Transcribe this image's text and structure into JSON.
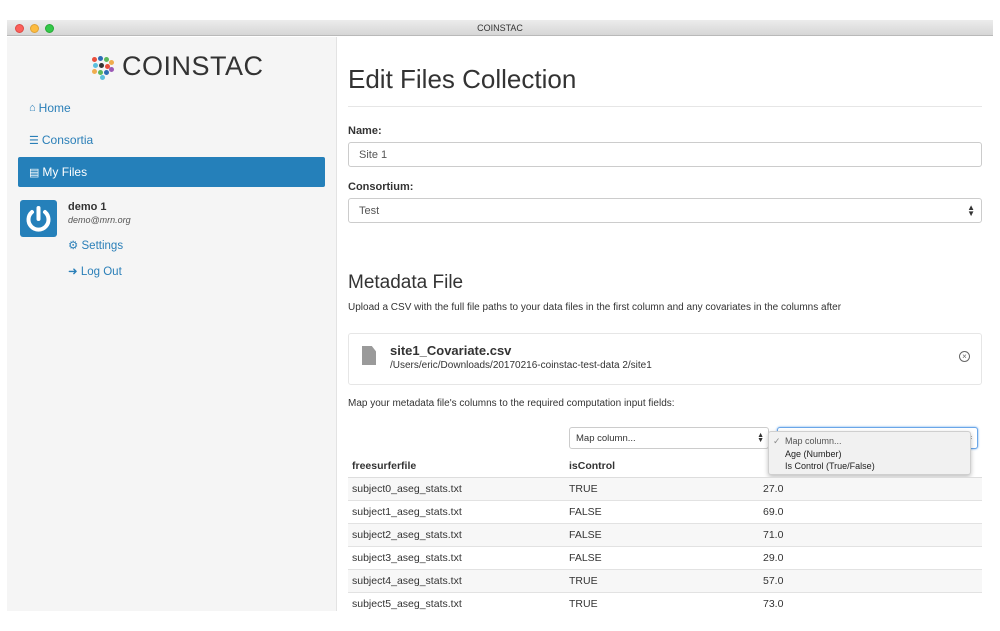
{
  "window": {
    "title": "COINSTAC"
  },
  "brand": {
    "name": "COINSTAC"
  },
  "sidebar": {
    "items": [
      {
        "label": "Home",
        "icon": "home-icon"
      },
      {
        "label": "Consortia",
        "icon": "list-icon"
      },
      {
        "label": "My Files",
        "icon": "file-list-icon"
      }
    ],
    "user": {
      "name": "demo 1",
      "email": "demo@mrn.org"
    },
    "links": {
      "settings": "Settings",
      "logout": "Log Out"
    }
  },
  "main": {
    "title": "Edit Files Collection",
    "name_label": "Name:",
    "name_value": "Site 1",
    "consortium_label": "Consortium:",
    "consortium_value": "Test",
    "metadata_title": "Metadata File",
    "metadata_desc": "Upload a CSV with the full file paths to your data files in the first column and any covariates in the columns after",
    "file": {
      "name": "site1_Covariate.csv",
      "path": "/Users/eric/Downloads/20170216-coinstac-test-data 2/site1"
    },
    "map_desc": "Map your metadata file's columns to the required computation input fields:",
    "map_select_1": "Map column...",
    "dropdown_options": [
      "Map column...",
      "Age (Number)",
      "Is Control (True/False)"
    ],
    "table": {
      "headers": [
        "freesurferfile",
        "isControl",
        ""
      ],
      "rows": [
        [
          "subject0_aseg_stats.txt",
          "TRUE",
          "27.0"
        ],
        [
          "subject1_aseg_stats.txt",
          "FALSE",
          "69.0"
        ],
        [
          "subject2_aseg_stats.txt",
          "FALSE",
          "71.0"
        ],
        [
          "subject3_aseg_stats.txt",
          "FALSE",
          "29.0"
        ],
        [
          "subject4_aseg_stats.txt",
          "TRUE",
          "57.0"
        ],
        [
          "subject5_aseg_stats.txt",
          "TRUE",
          "73.0"
        ]
      ]
    }
  },
  "colors": {
    "accent": "#2580ba",
    "link": "#2a7fb8"
  }
}
